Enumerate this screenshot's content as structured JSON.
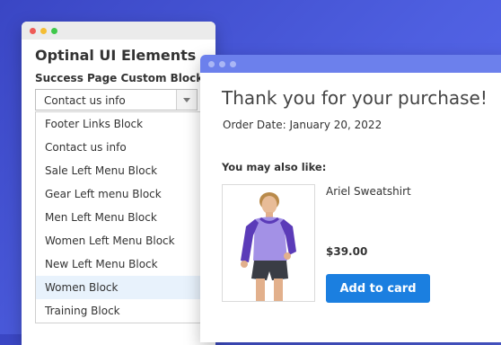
{
  "colors": {
    "accent": "#1b7fe0",
    "store_titlebar": "#6c80ec",
    "admin_titlebar": "#ebebeb",
    "dot_close": "#ee5b57",
    "dot_minimize": "#f4bd34",
    "dot_maximize": "#3fc84a",
    "selected_row": "#e8f2fc"
  },
  "admin_window": {
    "title": "Optinal UI Elements",
    "field_label": "Success Page Custom Block",
    "select": {
      "value": "Contact us info",
      "icon": "chevron-down-icon"
    },
    "options": [
      {
        "label": "Footer Links Block",
        "selected": false
      },
      {
        "label": "Contact us info",
        "selected": false
      },
      {
        "label": "Sale Left Menu Block",
        "selected": false
      },
      {
        "label": "Gear Left menu Block",
        "selected": false
      },
      {
        "label": "Men Left Menu Block",
        "selected": false
      },
      {
        "label": "Women Left Menu Block",
        "selected": false
      },
      {
        "label": "New Left Menu Block",
        "selected": false
      },
      {
        "label": "Women Block",
        "selected": true
      },
      {
        "label": "Training Block",
        "selected": false
      }
    ]
  },
  "store_window": {
    "heading": "Thank you for your purchase!",
    "order_date": "Order Date: January 20, 2022",
    "recommend_label": "You may also like:",
    "product": {
      "name": "Ariel Sweatshirt",
      "price": "$39.00",
      "image": "product-photo-sweatshirt",
      "button_label": "Add to card"
    }
  }
}
